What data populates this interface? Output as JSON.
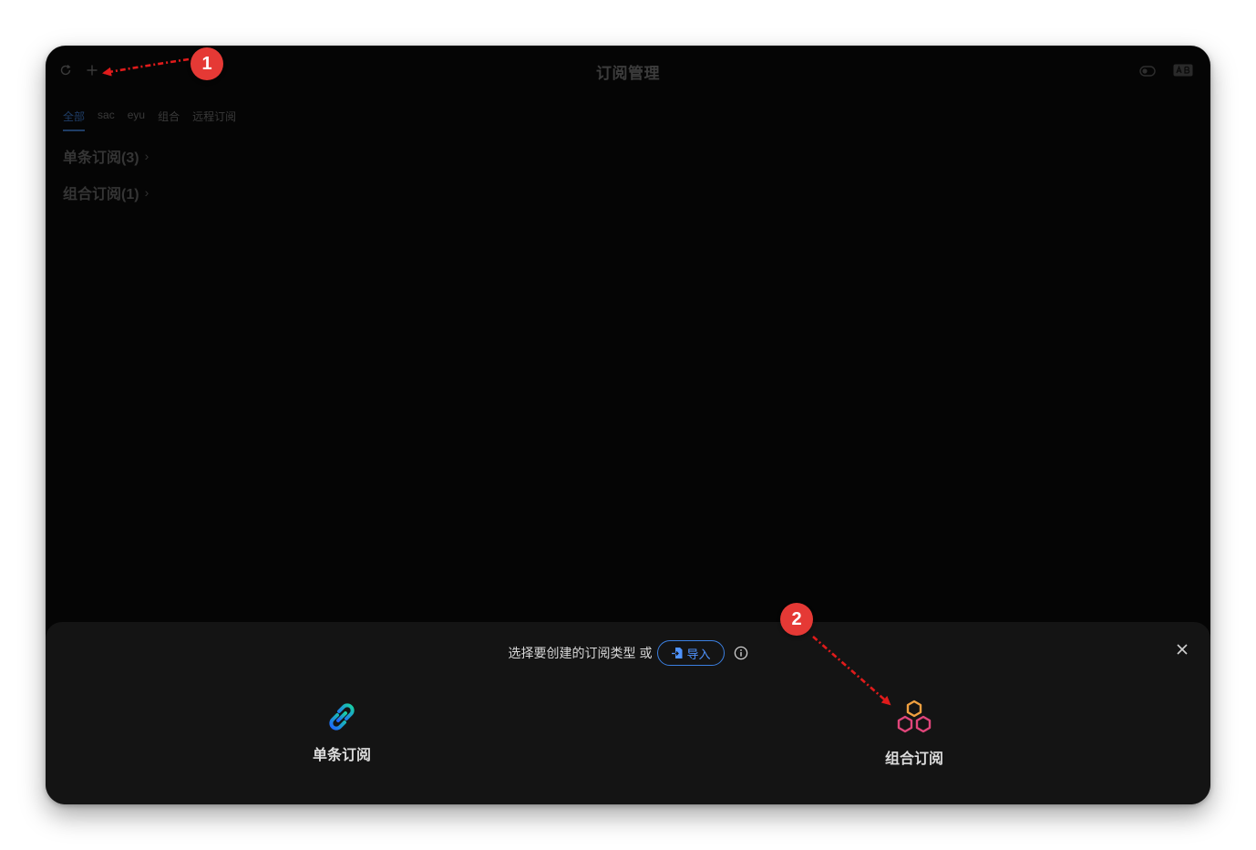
{
  "window": {
    "title": "订阅管理"
  },
  "tabs": [
    {
      "label": "全部",
      "active": true
    },
    {
      "label": "sac",
      "active": false
    },
    {
      "label": "eyu",
      "active": false
    },
    {
      "label": "组合",
      "active": false
    },
    {
      "label": "远程订阅",
      "active": false
    }
  ],
  "groups": [
    {
      "label": "单条订阅(3)"
    },
    {
      "label": "组合订阅(1)"
    }
  ],
  "sheet": {
    "prompt": "选择要创建的订阅类型",
    "or": "或",
    "import_label": "导入",
    "options": {
      "single_label": "单条订阅",
      "combo_label": "组合订阅"
    }
  },
  "annotations": {
    "badge1": "1",
    "badge2": "2"
  },
  "colors": {
    "accent": "#3b7fe0",
    "badge": "#e53935",
    "arrow": "#e01b1b"
  },
  "icons": {
    "refresh": "refresh-icon",
    "add": "plus-icon",
    "toggle": "toggle-icon",
    "ab": "ab-icon",
    "import": "file-import-icon",
    "info": "info-icon",
    "close": "close-icon",
    "single": "link-icon",
    "combo": "hexagons-icon"
  }
}
